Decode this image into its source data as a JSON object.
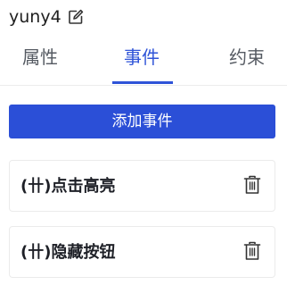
{
  "header": {
    "title": "yuny4",
    "edit_icon": "edit-icon"
  },
  "tabs": [
    {
      "label": "属性",
      "active": false
    },
    {
      "label": "事件",
      "active": true
    },
    {
      "label": "约束",
      "active": false
    }
  ],
  "actions": {
    "add_event_label": "添加事件"
  },
  "events": [
    {
      "name": "(卄)点击高亮",
      "delete_icon": "trash-icon"
    },
    {
      "name": "(卄)隐藏按钮",
      "delete_icon": "trash-icon"
    }
  ],
  "colors": {
    "accent": "#2b4fd7",
    "tab_active": "#2f54d8",
    "text": "#1e2027",
    "tab_inactive": "#555a62",
    "card_border": "#ebebeb"
  }
}
